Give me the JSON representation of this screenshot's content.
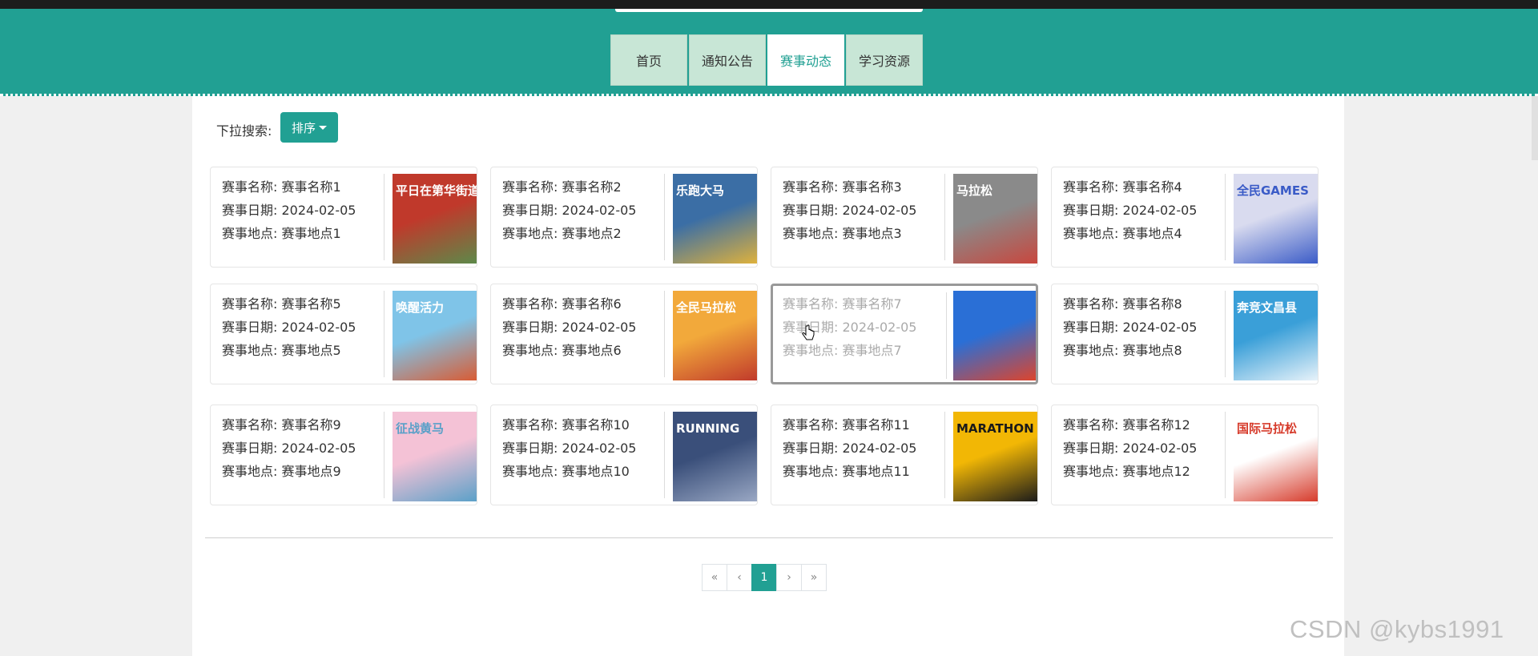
{
  "nav": {
    "items": [
      {
        "label": "首页",
        "active": false
      },
      {
        "label": "通知公告",
        "active": false
      },
      {
        "label": "赛事动态",
        "active": true
      },
      {
        "label": "学习资源",
        "active": false
      }
    ]
  },
  "filter": {
    "search_label": "下拉搜索:",
    "sort_label": "排序"
  },
  "events": [
    {
      "name_label": "赛事名称: 赛事名称1",
      "date_label": "赛事日期: 2024-02-05",
      "place_label": "赛事地点: 赛事地点1",
      "poster": {
        "text": "平日在第华街道",
        "colors": [
          "#c0392b",
          "#5c8a4a"
        ]
      }
    },
    {
      "name_label": "赛事名称: 赛事名称2",
      "date_label": "赛事日期: 2024-02-05",
      "place_label": "赛事地点: 赛事地点2",
      "poster": {
        "text": "乐跑大马",
        "colors": [
          "#3b6ea5",
          "#e0b23c"
        ]
      }
    },
    {
      "name_label": "赛事名称: 赛事名称3",
      "date_label": "赛事日期: 2024-02-05",
      "place_label": "赛事地点: 赛事地点3",
      "poster": {
        "text": "马拉松",
        "colors": [
          "#8a8a8a",
          "#c9463d"
        ]
      }
    },
    {
      "name_label": "赛事名称: 赛事名称4",
      "date_label": "赛事日期: 2024-02-05",
      "place_label": "赛事地点: 赛事地点4",
      "poster": {
        "text": "全民GAMES",
        "colors": [
          "#d9dbef",
          "#3a5bc7"
        ]
      }
    },
    {
      "name_label": "赛事名称: 赛事名称5",
      "date_label": "赛事日期: 2024-02-05",
      "place_label": "赛事地点: 赛事地点5",
      "poster": {
        "text": "唤醒活力",
        "colors": [
          "#7fc4e8",
          "#d95b33"
        ]
      }
    },
    {
      "name_label": "赛事名称: 赛事名称6",
      "date_label": "赛事日期: 2024-02-05",
      "place_label": "赛事地点: 赛事地点6",
      "poster": {
        "text": "全民马拉松",
        "colors": [
          "#f2a93b",
          "#c0392b"
        ]
      }
    },
    {
      "name_label": "赛事名称: 赛事名称7",
      "date_label": "赛事日期: 2024-02-05",
      "place_label": "赛事地点: 赛事地点7",
      "poster": {
        "text": "",
        "colors": [
          "#2a6fd6",
          "#e0442a"
        ]
      },
      "hover": true
    },
    {
      "name_label": "赛事名称: 赛事名称8",
      "date_label": "赛事日期: 2024-02-05",
      "place_label": "赛事地点: 赛事地点8",
      "poster": {
        "text": "奔竞文昌县",
        "colors": [
          "#3a9fd8",
          "#e9f3fa"
        ]
      }
    },
    {
      "name_label": "赛事名称: 赛事名称9",
      "date_label": "赛事日期: 2024-02-05",
      "place_label": "赛事地点: 赛事地点9",
      "poster": {
        "text": "征战黄马",
        "colors": [
          "#f4c2d6",
          "#5aa0c8"
        ]
      }
    },
    {
      "name_label": "赛事名称: 赛事名称10",
      "date_label": "赛事日期: 2024-02-05",
      "place_label": "赛事地点: 赛事地点10",
      "poster": {
        "text": "RUNNING",
        "colors": [
          "#3a4f7a",
          "#9aa8c4"
        ]
      }
    },
    {
      "name_label": "赛事名称: 赛事名称11",
      "date_label": "赛事日期: 2024-02-05",
      "place_label": "赛事地点: 赛事地点11",
      "poster": {
        "text": "MARATHON",
        "colors": [
          "#f2b705",
          "#1a1a1a"
        ]
      }
    },
    {
      "name_label": "赛事名称: 赛事名称12",
      "date_label": "赛事日期: 2024-02-05",
      "place_label": "赛事地点: 赛事地点12",
      "poster": {
        "text": "国际马拉松",
        "colors": [
          "#ffffff",
          "#d63a2a"
        ]
      }
    }
  ],
  "pagination": {
    "first": "«",
    "prev": "‹",
    "current": "1",
    "next": "›",
    "last": "»"
  },
  "watermark": "CSDN @kybs1991",
  "colors": {
    "accent": "#21a093",
    "nav_inactive": "#c8e6d6"
  }
}
